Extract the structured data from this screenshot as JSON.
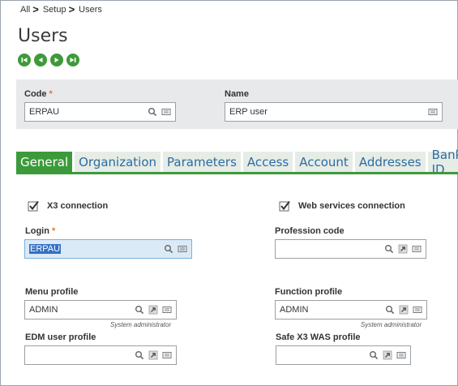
{
  "breadcrumb": [
    "All",
    "Setup",
    "Users"
  ],
  "page_title": "Users",
  "nav_buttons": [
    "first-record-icon",
    "previous-record-icon",
    "next-record-icon",
    "last-record-icon"
  ],
  "header": {
    "code_label": "Code",
    "code_value": "ERPAU",
    "name_label": "Name",
    "name_value": "ERP user"
  },
  "tabs": [
    "General",
    "Organization",
    "Parameters",
    "Access",
    "Account",
    "Addresses",
    "Bank ID"
  ],
  "general": {
    "x3_connection": "X3 connection",
    "web_services_connection": "Web services connection",
    "login_label": "Login",
    "login_value": "ERPAU",
    "profession_code_label": "Profession code",
    "profession_code_value": "",
    "menu_profile_label": "Menu profile",
    "menu_profile_value": "ADMIN",
    "menu_profile_desc": "System administrator",
    "function_profile_label": "Function profile",
    "function_profile_value": "ADMIN",
    "function_profile_desc": "System administrator",
    "edm_user_profile_label": "EDM user profile",
    "edm_user_profile_value": "",
    "safe_x3_was_profile_label": "Safe X3 WAS profile",
    "safe_x3_was_profile_value": ""
  },
  "colors": {
    "accent_green": "#3d9a3a",
    "tab_text_blue": "#2d6ca2",
    "required_orange": "#e87722"
  }
}
